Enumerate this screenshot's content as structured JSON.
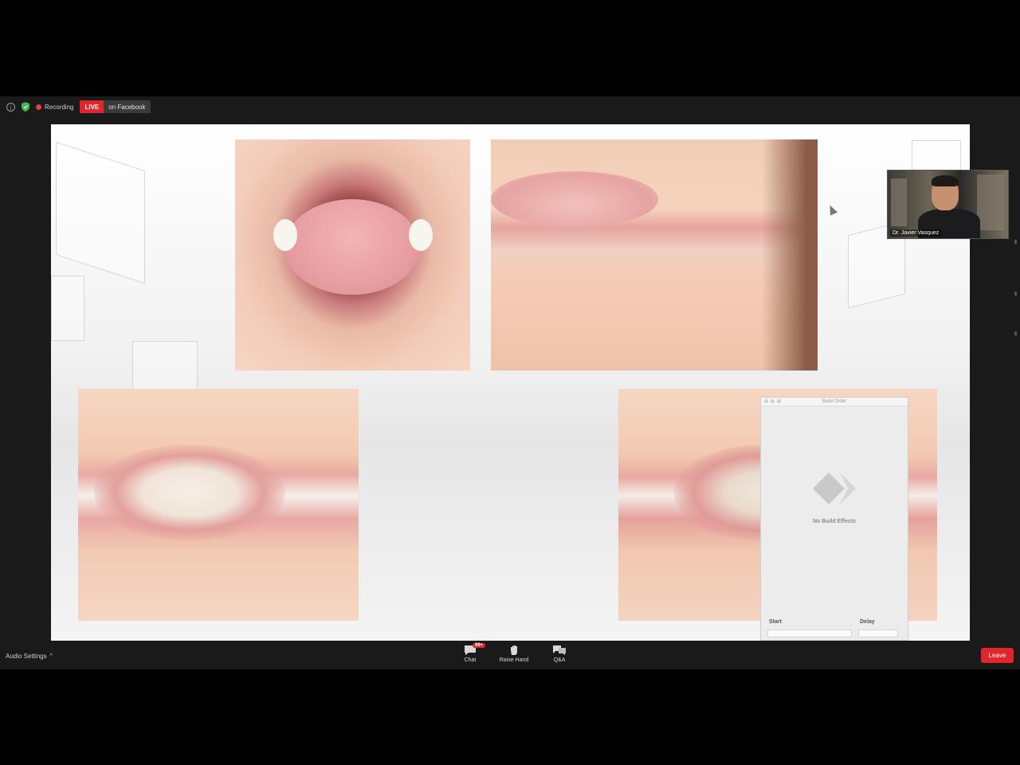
{
  "meeting": {
    "recording_label": "Recording",
    "live_badge": "LIVE",
    "live_destination": "on Facebook"
  },
  "video_tile": {
    "participant_name": "Dr. Javier Vasquez"
  },
  "build_order_panel": {
    "title": "Build Order",
    "empty_message": "No Build Effects",
    "start_label": "Start",
    "delay_label": "Delay"
  },
  "toolbar": {
    "audio_settings_label": "Audio Settings",
    "chat_label": "Chat",
    "chat_badge": "99+",
    "raise_hand_label": "Raise Hand",
    "qa_label": "Q&A",
    "leave_label": "Leave"
  },
  "colors": {
    "leave_red": "#e0252b",
    "live_red": "#e0252b",
    "shield_green": "#3fb950"
  }
}
